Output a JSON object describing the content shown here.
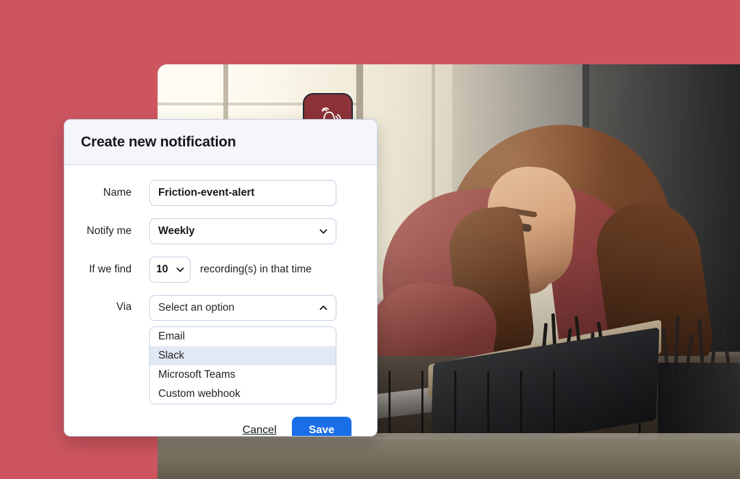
{
  "theme": {
    "page_background": "#cc555f",
    "accent_blue": "#1a6ee8",
    "badge_red": "#8c3238",
    "header_bg": "#f4f6fc",
    "option_highlight": "#e3e9f4",
    "border": "#c3cde2"
  },
  "badge": {
    "icon": "bell-ringing-icon"
  },
  "dialog": {
    "title": "Create new notification",
    "fields": [
      {
        "label": "Name",
        "control": "text",
        "value": "Friction-event-alert",
        "placeholder": ""
      },
      {
        "label": "Notify me",
        "control": "select",
        "value": "Weekly",
        "chevron": "chevron-down-icon"
      },
      {
        "label": "If we find",
        "control": "stepper",
        "value": "10",
        "chevron": "chevron-down-icon",
        "suffix": "recording(s) in that time"
      },
      {
        "label": "Via",
        "control": "select",
        "value": "Select an option",
        "chevron": "chevron-up-icon",
        "is_placeholder": true
      }
    ],
    "via_options": [
      {
        "label": "Email",
        "highlighted": false
      },
      {
        "label": "Slack",
        "highlighted": true
      },
      {
        "label": "Microsoft Teams",
        "highlighted": false
      },
      {
        "label": "Custom webhook",
        "highlighted": false
      }
    ],
    "actions": {
      "cancel_label": "Cancel",
      "save_label": "Save"
    }
  },
  "photo": {
    "description": "Woman with curly hair working at a laptop on a desk near a bright window"
  }
}
